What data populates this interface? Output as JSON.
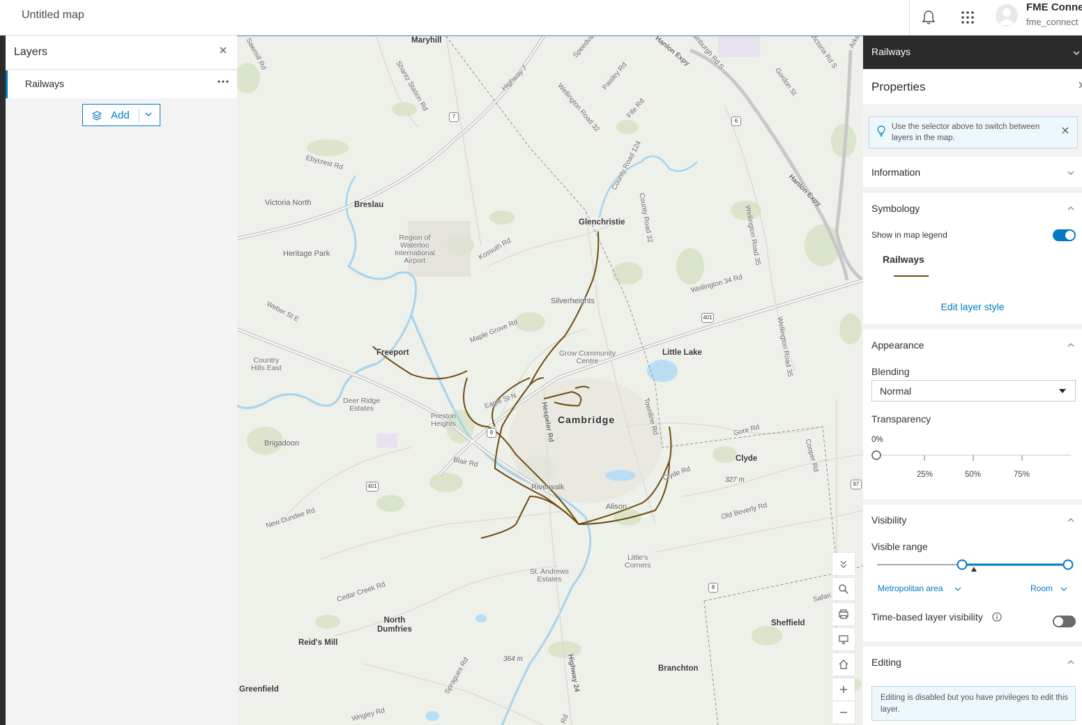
{
  "header": {
    "map_title": "Untitled map",
    "user_name": "FME Conne",
    "user_handle": "fme_connect"
  },
  "layers_panel": {
    "title": "Layers",
    "layers": [
      {
        "name": "Railways"
      }
    ],
    "add_label": "Add"
  },
  "map": {
    "rail_color": "#6e4b10",
    "places": {
      "maryhill": "Maryhill",
      "breslau": "Breslau",
      "victoria_north": "Victoria North",
      "heritage_park": "Heritage Park",
      "glenchristie": "Glenchristie",
      "silverheights": "Silverheights",
      "freeport": "Freeport",
      "country_hills_east": "Country\nHills East",
      "deer_ridge": "Deer Ridge\nEstates",
      "preston_heights": "Preston\nHeights",
      "brigadoon": "Brigadoon",
      "cambridge": "Cambridge",
      "grow_community": "Grow Community\nCentre",
      "little_lake": "Little Lake",
      "clyde": "Clyde",
      "riverwalk": "Riverwalk",
      "alison": "Alison",
      "littles_corners": "Little's\nCorners",
      "st_andrews": "St. Andrews\nEstates",
      "north_dumfries": "North\nDumfries",
      "reids_mill": "Reid's Mill",
      "sheffield": "Sheffield",
      "branchton": "Branchton",
      "greenfield": "Greenfield",
      "airport": "Region of\nWaterloo\nInternational\nAirport"
    },
    "roads": {
      "sawmill": "Sawmill Rd",
      "shantz": "Shantz Station Rd",
      "highway7": "Highway 7",
      "speedvale": "Speedvale",
      "paisley": "Paisley Rd",
      "wellington32a": "Wellington Road 32",
      "fife": "Fife Rd",
      "hanlon1": "Hanlon Expy",
      "edinburgh": "Edinburgh Rd S",
      "victoria_rd": "Victoria Rd S",
      "gordon": "Gordon St",
      "arkell": "Arke",
      "ebycrest": "Ebycrest Rd",
      "county124": "County Road 124",
      "county32": "County Road 32",
      "hanlon2": "Hanlon Expy",
      "wellington35a": "Wellington Road 35",
      "wellington34": "Wellington 34 Rd",
      "kossuth": "Kossuth Rd",
      "weber": "Weber St E",
      "maple_grove": "Maple Grove Rd",
      "eagle": "Eagle St N",
      "hespeler": "Hespeler Rd",
      "townline": "Townline Rd",
      "wellington35b": "Wellington Road 35",
      "gore": "Gore Rd",
      "cooper": "Cooper Rd",
      "blair": "Blair Rd",
      "clyde_rd": "Clyde Rd",
      "old_beverly": "Old Beverly Rd",
      "new_dundee": "New Dundee Rd",
      "cedar_creek": "Cedar Creek Rd",
      "safari": "Safari",
      "sprague": "Spragues Rd",
      "highway24": "Highway 24",
      "wrigley": "Wrigley Rd",
      "rd_bottom": "Rd"
    },
    "shields": {
      "s7": "7",
      "s6": "6",
      "s401a": "401",
      "s8a": "8",
      "s401b": "401",
      "s97": "97",
      "s8b": "8"
    },
    "elevations": {
      "e1": "327 m",
      "e2": "364 m"
    },
    "controls": [
      "collapse-icon",
      "search-icon",
      "print-icon",
      "screen-icon",
      "home-icon",
      "zoom-in-icon",
      "zoom-out-icon"
    ]
  },
  "properties": {
    "selected_layer": "Railways",
    "title": "Properties",
    "tip": "Use the selector above to switch between layers in the map.",
    "information": {
      "title": "Information"
    },
    "symbology": {
      "title": "Symbology",
      "show_in_legend_label": "Show in map legend",
      "show_in_legend": true,
      "legend_layer": "Railways",
      "edit_style": "Edit layer style"
    },
    "appearance": {
      "title": "Appearance",
      "blending_label": "Blending",
      "blending_value": "Normal",
      "transparency_label": "Transparency",
      "transparency_value": "0%",
      "transparency_fraction": 0,
      "ticks": [
        "25%",
        "50%",
        "75%"
      ]
    },
    "visibility": {
      "title": "Visibility",
      "visible_range_label": "Visible range",
      "min_scale": "Metropolitan area",
      "max_scale": "Room",
      "time_based_label": "Time-based layer visibility",
      "time_based": false
    },
    "editing": {
      "title": "Editing",
      "note": "Editing is disabled but you have privileges to edit this layer."
    }
  }
}
